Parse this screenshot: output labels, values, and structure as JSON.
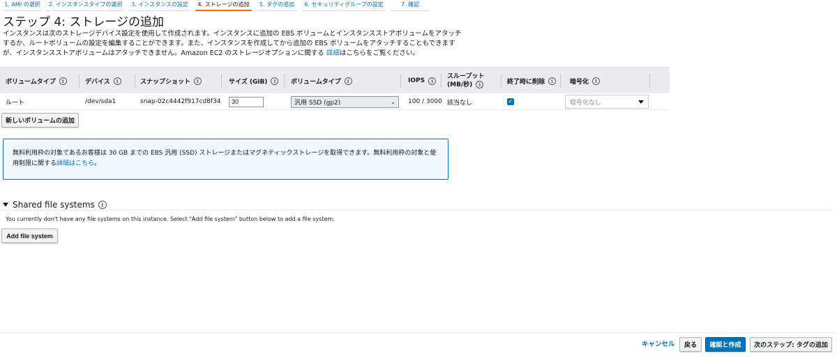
{
  "wizard": {
    "steps": [
      "1. AMI の選択",
      "2. インスタンスタイプの選択",
      "3. インスタンスの設定",
      "4. ストレージの追加",
      "5. タグの追加",
      "6. セキュリティグループの設定",
      "7. 確認"
    ],
    "active_step": 3
  },
  "page": {
    "title": "ステップ 4: ストレージの追加",
    "description_1": "インスタンスは次のストレージデバイス設定を使用して作成されます。インスタンスに追加の EBS ボリュームとインスタンスストアボリュームをアタッチするか、ルートボリュームの設定を編集することができます。また、インスタンスを作成してから追加の EBS ボリュームをアタッチすることもできますが、インスタンスストアボリュームはアタッチできません。Amazon EC2 のストレージオプションに関する",
    "description_link": "詳細",
    "description_2": "はこちらをご覧ください。"
  },
  "table": {
    "headers": {
      "volume_type": "ボリュームタイプ",
      "device": "デバイス",
      "snapshot": "スナップショット",
      "size": "サイズ (GiB)",
      "volume_type_2": "ボリュームタイプ",
      "iops": "IOPS",
      "throughput_1": "スループット",
      "throughput_2": "(MB/秒)",
      "delete_on_term": "終了時に削除",
      "encryption": "暗号化"
    },
    "info_glyph": "i",
    "row": {
      "volume_type": "ルート",
      "device": "/dev/sda1",
      "snapshot": "snap-02c4442f917cd8f34",
      "size": "30",
      "volume_type_select": "汎用 SSD (gp2)",
      "iops": "100 / 3000",
      "throughput": "該当なし",
      "delete_on_termination": true,
      "encryption": "暗号化なし"
    }
  },
  "add_volume_button": "新しいボリュームの追加",
  "info_box": {
    "text": "無料利用枠の対象であるお客様は 30 GB までの EBS 汎用 (SSD) ストレージまたはマグネティックストレージを取得できます。無料利用枠の対象と使用制限に関する",
    "link": "詳細はこちら",
    "suffix": "。"
  },
  "shared_fs": {
    "title": "Shared file systems",
    "message": "You currently don't have any file systems on this instance. Select \"Add file system\" button below to add a file system.",
    "add_button": "Add file system"
  },
  "footer": {
    "cancel": "キャンセル",
    "back": "戻る",
    "review_launch": "確認と作成",
    "next": "次のステップ: タグの追加"
  },
  "colors": {
    "accent": "#ec7211",
    "link": "#0073bb",
    "primary_button": "#0073bb",
    "info_box_bg": "#f1faff"
  }
}
